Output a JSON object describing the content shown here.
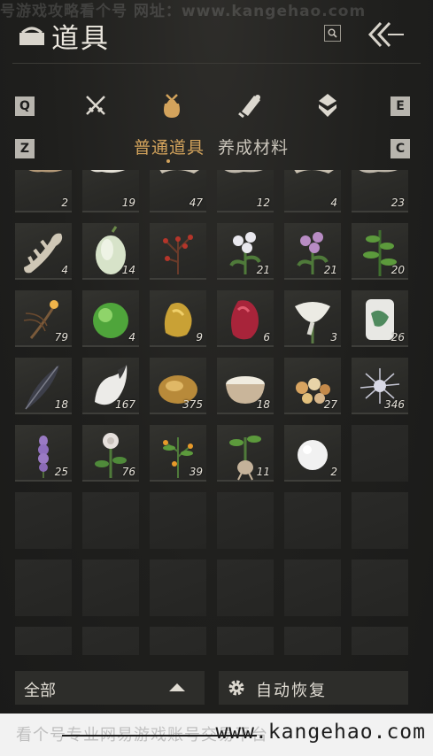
{
  "watermark_top": "号游戏攻略看个号  网址：www.kangehao.com",
  "header": {
    "title": "道具"
  },
  "keys": {
    "prev_category": "Q",
    "next_category": "E",
    "prev_subtab": "Z",
    "next_subtab": "C"
  },
  "categories": [
    {
      "name": "weapons",
      "icon": "crossed-swords-icon"
    },
    {
      "name": "items",
      "icon": "pouch-icon",
      "active": true
    },
    {
      "name": "scrolls",
      "icon": "scroll-icon"
    },
    {
      "name": "gems",
      "icon": "gem-icon"
    }
  ],
  "subtabs": [
    {
      "label": "普通道具",
      "active": true
    },
    {
      "label": "养成材料",
      "active": false
    }
  ],
  "inventory": [
    {
      "icon": "bark-icon",
      "qty": "2"
    },
    {
      "icon": "white-moss-icon",
      "qty": "19"
    },
    {
      "icon": "coral-icon",
      "qty": "47"
    },
    {
      "icon": "fossil-icon",
      "qty": "12"
    },
    {
      "icon": "coral-icon",
      "qty": "4"
    },
    {
      "icon": "fossil-icon",
      "qty": "23"
    },
    {
      "icon": "bone-icon",
      "qty": "4"
    },
    {
      "icon": "gourd-icon",
      "qty": "14"
    },
    {
      "icon": "red-berry-twig-icon",
      "qty": ""
    },
    {
      "icon": "white-flower-icon",
      "qty": "21"
    },
    {
      "icon": "purple-flower-icon",
      "qty": "21"
    },
    {
      "icon": "herb-icon",
      "qty": "20"
    },
    {
      "icon": "incense-icon",
      "qty": "79"
    },
    {
      "icon": "jade-orb-icon",
      "qty": "4"
    },
    {
      "icon": "gold-nugget-icon",
      "qty": "9"
    },
    {
      "icon": "ruby-icon",
      "qty": "6"
    },
    {
      "icon": "white-lily-icon",
      "qty": "3"
    },
    {
      "icon": "porcelain-jar-icon",
      "qty": "26"
    },
    {
      "icon": "dark-feather-icon",
      "qty": "18"
    },
    {
      "icon": "white-fur-icon",
      "qty": "167"
    },
    {
      "icon": "gold-ore-icon",
      "qty": "375"
    },
    {
      "icon": "rice-bowl-icon",
      "qty": "18"
    },
    {
      "icon": "pebbles-icon",
      "qty": "27"
    },
    {
      "icon": "silver-thistle-icon",
      "qty": "346"
    },
    {
      "icon": "lavender-icon",
      "qty": "25"
    },
    {
      "icon": "white-rose-icon",
      "qty": "76"
    },
    {
      "icon": "orange-fruit-bush-icon",
      "qty": "39"
    },
    {
      "icon": "root-herb-icon",
      "qty": "11"
    },
    {
      "icon": "snowball-icon",
      "qty": "2"
    },
    {
      "icon": "empty",
      "qty": ""
    }
  ],
  "footer": {
    "filter_label": "全部",
    "auto_label": "自动恢复"
  },
  "watermark_bottom": {
    "text": "看个号专业网易游戏账号交易平台",
    "url": "www.kangehao.com"
  }
}
